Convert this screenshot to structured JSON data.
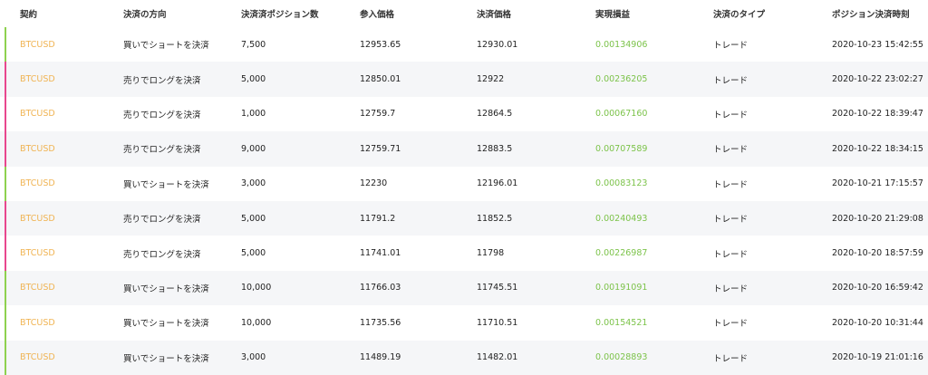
{
  "colors": {
    "contract": "#f0b454",
    "pnl": "#7cc34a",
    "buy_marker": "#8ed14f",
    "sell_marker": "#e8478e",
    "stripe": "#f5f6f8"
  },
  "headers": [
    "契約",
    "決済の方向",
    "決済済ポジション数",
    "参入価格",
    "決済価格",
    "実現損益",
    "決済のタイプ",
    "ポジション決済時刻"
  ],
  "rows": [
    {
      "side": "buy",
      "contract": "BTCUSD",
      "direction": "買いでショートを決済",
      "qty": "7,500",
      "entry": "12953.65",
      "exit": "12930.01",
      "pnl": "0.00134906",
      "type": "トレード",
      "time": "2020-10-23 15:42:55"
    },
    {
      "side": "sell",
      "contract": "BTCUSD",
      "direction": "売りでロングを決済",
      "qty": "5,000",
      "entry": "12850.01",
      "exit": "12922",
      "pnl": "0.00236205",
      "type": "トレード",
      "time": "2020-10-22 23:02:27"
    },
    {
      "side": "sell",
      "contract": "BTCUSD",
      "direction": "売りでロングを決済",
      "qty": "1,000",
      "entry": "12759.7",
      "exit": "12864.5",
      "pnl": "0.00067160",
      "type": "トレード",
      "time": "2020-10-22 18:39:47"
    },
    {
      "side": "sell",
      "contract": "BTCUSD",
      "direction": "売りでロングを決済",
      "qty": "9,000",
      "entry": "12759.71",
      "exit": "12883.5",
      "pnl": "0.00707589",
      "type": "トレード",
      "time": "2020-10-22 18:34:15"
    },
    {
      "side": "buy",
      "contract": "BTCUSD",
      "direction": "買いでショートを決済",
      "qty": "3,000",
      "entry": "12230",
      "exit": "12196.01",
      "pnl": "0.00083123",
      "type": "トレード",
      "time": "2020-10-21 17:15:57"
    },
    {
      "side": "sell",
      "contract": "BTCUSD",
      "direction": "売りでロングを決済",
      "qty": "5,000",
      "entry": "11791.2",
      "exit": "11852.5",
      "pnl": "0.00240493",
      "type": "トレード",
      "time": "2020-10-20 21:29:08"
    },
    {
      "side": "sell",
      "contract": "BTCUSD",
      "direction": "売りでロングを決済",
      "qty": "5,000",
      "entry": "11741.01",
      "exit": "11798",
      "pnl": "0.00226987",
      "type": "トレード",
      "time": "2020-10-20 18:57:59"
    },
    {
      "side": "buy",
      "contract": "BTCUSD",
      "direction": "買いでショートを決済",
      "qty": "10,000",
      "entry": "11766.03",
      "exit": "11745.51",
      "pnl": "0.00191091",
      "type": "トレード",
      "time": "2020-10-20 16:59:42"
    },
    {
      "side": "buy",
      "contract": "BTCUSD",
      "direction": "買いでショートを決済",
      "qty": "10,000",
      "entry": "11735.56",
      "exit": "11710.51",
      "pnl": "0.00154521",
      "type": "トレード",
      "time": "2020-10-20 10:31:44"
    },
    {
      "side": "buy",
      "contract": "BTCUSD",
      "direction": "買いでショートを決済",
      "qty": "3,000",
      "entry": "11489.19",
      "exit": "11482.01",
      "pnl": "0.00028893",
      "type": "トレード",
      "time": "2020-10-19 21:01:16"
    }
  ]
}
